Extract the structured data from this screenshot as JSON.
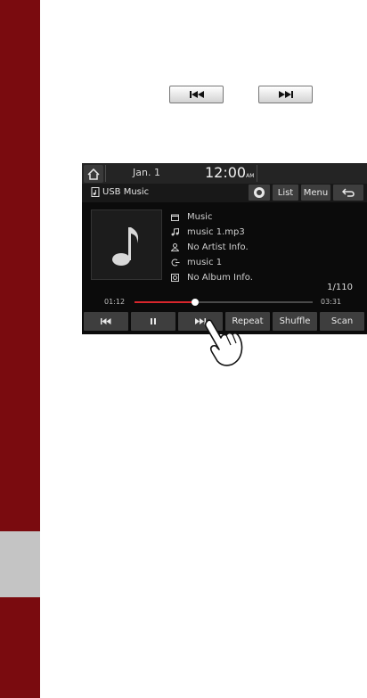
{
  "hardware_buttons": {
    "prev_icon": "seek-back-icon",
    "next_icon": "seek-forward-icon"
  },
  "status_bar": {
    "home_icon": "home-icon",
    "date": "Jan.  1",
    "time": "12:00",
    "ampm": "AM"
  },
  "source_bar": {
    "source_icon": "usb-music-icon",
    "source_label": "USB Music",
    "connect_icon": "sound-logo-icon",
    "list_label": "List",
    "menu_label": "Menu",
    "back_icon": "back-icon"
  },
  "album_art_icon": "music-note-icon",
  "track_info": {
    "folder": "Music",
    "file": "music 1.mp3",
    "artist": "No Artist Info.",
    "title": "music 1",
    "album": "No Album Info."
  },
  "track_counter": "1/110",
  "progress": {
    "current": "01:12",
    "total": "03:31",
    "fraction": 0.34
  },
  "controls": {
    "prev_icon": "previous-track-icon",
    "pause_icon": "pause-icon",
    "next_icon": "next-track-icon",
    "repeat_label": "Repeat",
    "shuffle_label": "Shuffle",
    "scan_label": "Scan"
  },
  "colors": {
    "sidebar": "#7a0b0f",
    "progress": "#d8262c",
    "screen": "#0b0b0b"
  }
}
